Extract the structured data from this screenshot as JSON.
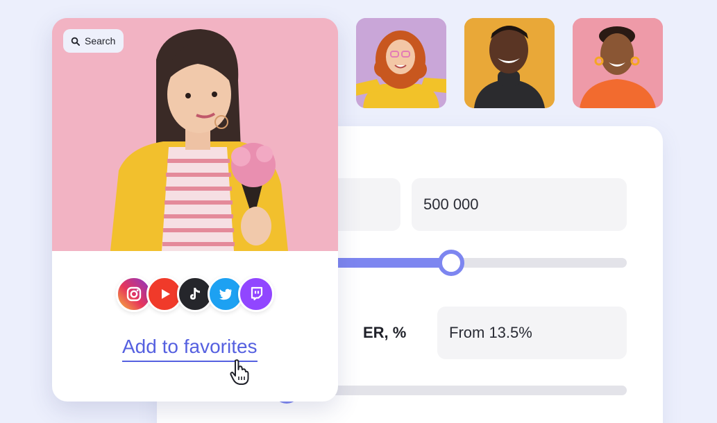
{
  "search": {
    "label": "Search"
  },
  "profile": {
    "socials": [
      "instagram-icon",
      "youtube-icon",
      "tiktok-icon",
      "twitter-icon",
      "twitch-icon"
    ],
    "favorites_link": "Add to favorites"
  },
  "filters": {
    "followers": {
      "min": "",
      "max": "500 000",
      "range_fill": 0.52
    },
    "er": {
      "label": "ER, %",
      "value": "From 13.5%",
      "range_fill": 0.07
    }
  },
  "colors": {
    "accent": "#7d86f0",
    "link": "#5560e0",
    "background": "#eceffc",
    "photo_background": "#f2b3c3"
  }
}
